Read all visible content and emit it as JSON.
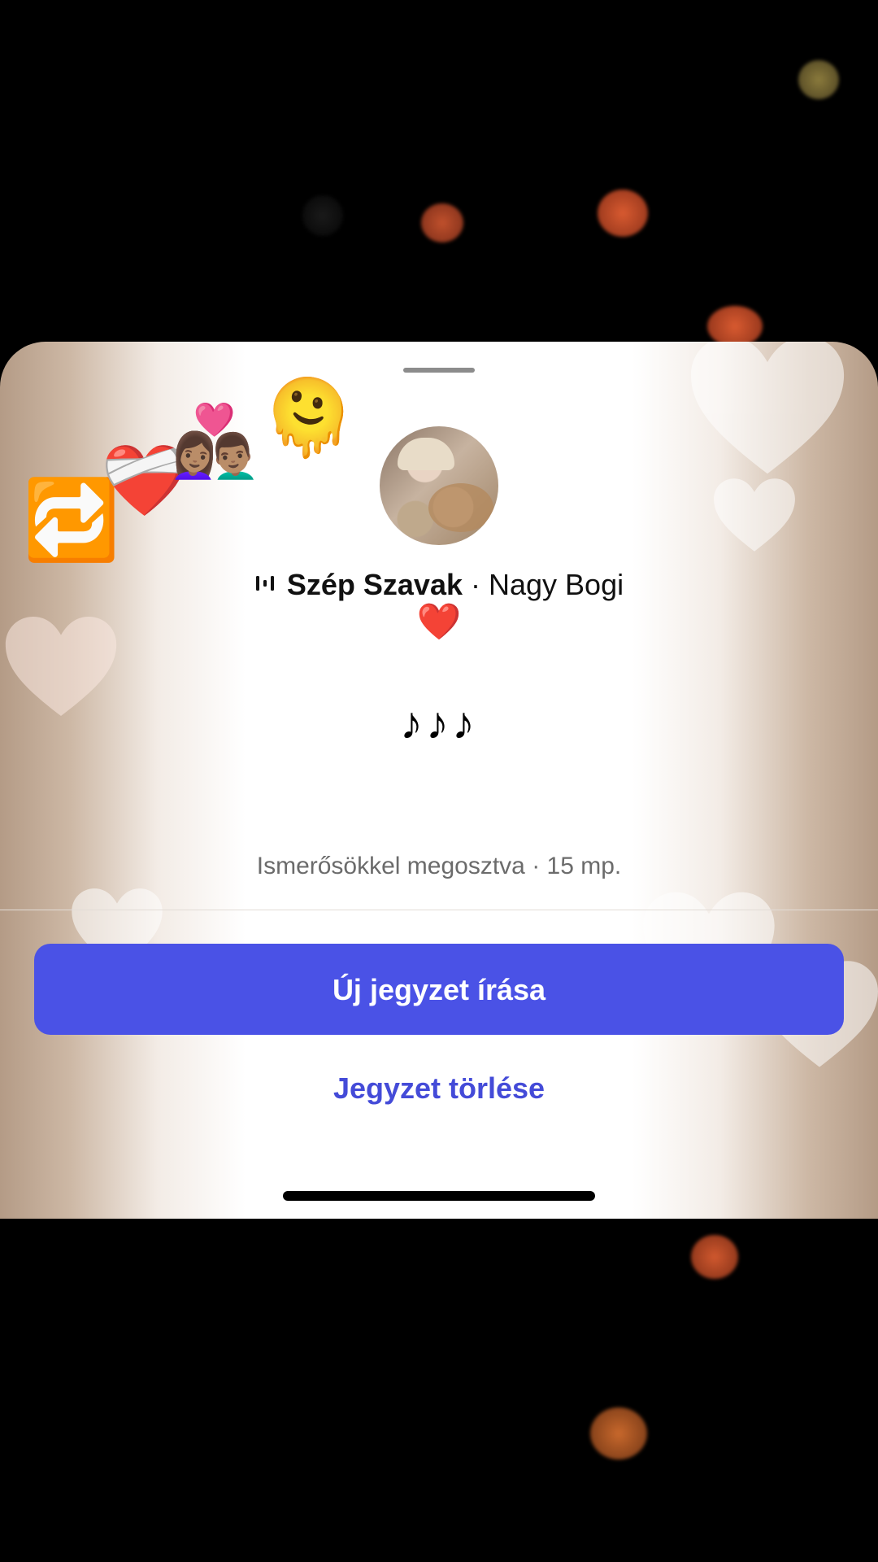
{
  "note": {
    "song_title": "Szép Szavak",
    "separator": " · ",
    "artist": "Nagy Bogi",
    "heart": "❤️",
    "text": "♪♪♪",
    "meta": "Ismerősökkel megosztva · 15 mp."
  },
  "emoji_trail": [
    "🔁",
    "❤️‍🩹",
    "👩🏽‍❤️‍👨🏽",
    "🫠"
  ],
  "actions": {
    "new_note": "Új jegyzet írása",
    "delete_note": "Jegyzet törlése"
  },
  "colors": {
    "primary_button": "#4a52e6",
    "link": "#444bd8"
  },
  "icons": {
    "song": "audio-wave-icon"
  }
}
